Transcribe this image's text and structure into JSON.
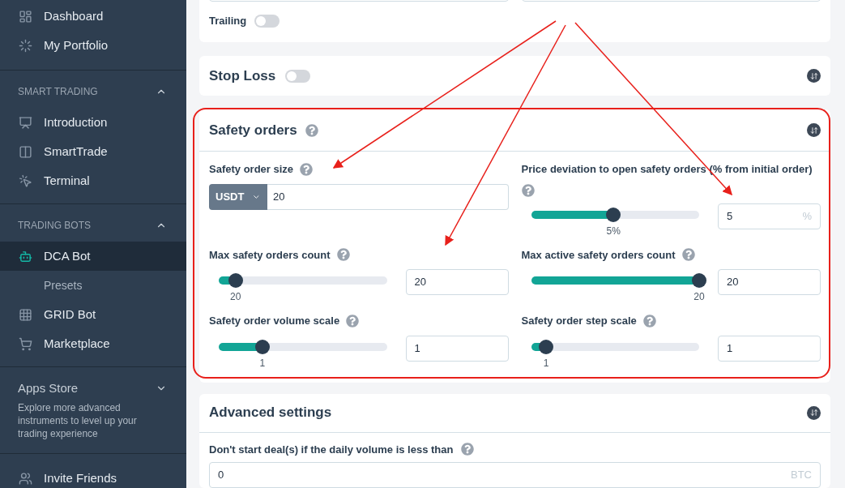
{
  "sidebar": {
    "top_items": [
      {
        "label": "Dashboard",
        "selected": false
      },
      {
        "label": "My Portfolio",
        "selected": false
      }
    ],
    "sections": [
      {
        "title": "SMART TRADING",
        "expanded": true,
        "items": [
          {
            "label": "Introduction",
            "selected": false,
            "kind": "main"
          },
          {
            "label": "SmartTrade",
            "selected": false,
            "kind": "main"
          },
          {
            "label": "Terminal",
            "selected": false,
            "kind": "main"
          }
        ]
      },
      {
        "title": "TRADING BOTS",
        "expanded": true,
        "items": [
          {
            "label": "DCA Bot",
            "selected": true,
            "kind": "main"
          },
          {
            "label": "Presets",
            "selected": false,
            "kind": "sub"
          },
          {
            "label": "GRID Bot",
            "selected": false,
            "kind": "main"
          },
          {
            "label": "Marketplace",
            "selected": false,
            "kind": "main"
          }
        ]
      }
    ],
    "apps_store": {
      "title": "Apps Store",
      "expanded": false,
      "description": "Explore more advanced instruments to level up your trading experience"
    },
    "bottom_items": [
      {
        "label": "Invite Friends",
        "selected": false
      }
    ]
  },
  "trailing": {
    "label": "Trailing",
    "on": false
  },
  "stop_loss": {
    "title": "Stop Loss",
    "on": false
  },
  "safety_orders": {
    "title": "Safety orders",
    "order_size": {
      "label": "Safety order size",
      "currency": "USDT",
      "value": "20"
    },
    "sliders": [
      {
        "label": "Price deviation to open safety orders (% from initial order)",
        "level": 0.49,
        "reading": "5%",
        "value": "5",
        "unit": "%"
      },
      {
        "label": "Max safety orders count",
        "level": 0.1,
        "reading": "20",
        "value": "20"
      },
      {
        "label": "Max active safety orders count",
        "level": 1,
        "reading": "20",
        "value": "20"
      },
      {
        "label": "Safety order volume scale",
        "level": 0.26,
        "reading": "1",
        "value": "1"
      },
      {
        "label": "Safety order step scale",
        "level": 0.09,
        "reading": "1",
        "value": "1"
      }
    ]
  },
  "advanced": {
    "title": "Advanced settings",
    "field": {
      "label": "Don't start deal(s) if the daily volume is less than",
      "value": "0",
      "unit": "BTC"
    }
  }
}
